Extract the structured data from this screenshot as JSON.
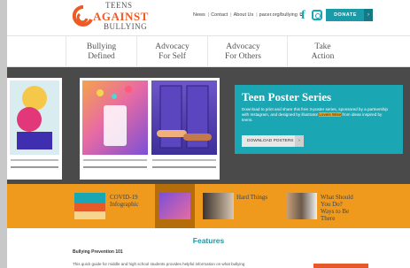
{
  "header": {
    "logo": {
      "line1": "TEENS",
      "line2": "AGAINST",
      "line3": "BULLYING"
    },
    "top_links": [
      "News",
      "Contact",
      "About Us",
      "pacer.org/bullying"
    ],
    "donate_label": "DONATE",
    "donate_arrow": "›"
  },
  "main_nav": {
    "items": [
      {
        "line1": "Bullying",
        "line2": "Defined"
      },
      {
        "line1": "Advocacy",
        "line2": "For Self"
      },
      {
        "line1": "Advocacy",
        "line2": "For Others"
      },
      {
        "line1": "Take",
        "line2": "Action"
      }
    ]
  },
  "hero": {
    "title": "Teen Poster Series",
    "body_before_link": "Download to print and share this free 3-poster series, sponsored by a partnership with Instagram, and designed by illustrator",
    "body_link": "Loveis Wise",
    "body_after_link": "from ideas inspired by teens.",
    "button_label": "DOWNLOAD POSTERS",
    "button_arrow": "›"
  },
  "resources": {
    "items": [
      {
        "label_line1": "COVID-19",
        "label_line2": "Infographic"
      },
      {
        "label_line1": "",
        "label_line2": ""
      },
      {
        "label_line1": "Hard Things",
        "label_line2": ""
      },
      {
        "label_line1": "What Should",
        "label_line2": "You Do?",
        "label_line3": "Ways to Be",
        "label_line4": "There"
      }
    ]
  },
  "features": {
    "title": "Features",
    "item_title": "Bullying Prevention 101",
    "item_body": "This quick guide for middle and high school students provides helpful information on what bullying"
  },
  "colors": {
    "teal": "#1ba6b3",
    "orange": "#ef9a1d",
    "brand": "#ee5a24"
  }
}
